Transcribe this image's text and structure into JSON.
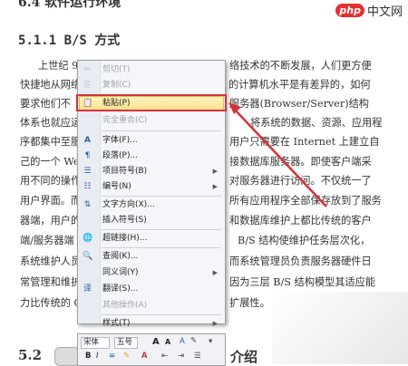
{
  "document": {
    "heading_top": "6.4 软件运行环境",
    "heading_sub": "5.1.1 B/S 方式",
    "left_lines": [
      "上世纪 9",
      "快捷地从网络",
      "要求他们不",
      "体系也就应运",
      "序都集中至服",
      "己的一个 Web",
      "用不同的操作",
      "用户界面。而",
      "器端，用户的",
      "端/服务器端",
      "系统维护人员",
      "常管理和维护",
      "力比传统的 C"
    ],
    "right_lines": [
      "络技术的不断发展，人们更方便",
      "的计算机水平是有差异的，如何",
      "服务器(Browser/Server)结构",
      "将系统的数据、资源、应用程",
      "用户只需要在 Internet 上建立自",
      "接数据库服务器。即使客户端采",
      "对服务器进行访问。不仅统一了",
      "所有应用程序全部保存放到了服务",
      "和数据库维护上都比传统的客户",
      "B/S 结构使维护任务层次化，",
      "而系统管理员负责服务器硬件日",
      "因为三层 B/S 结构模型其适应能",
      "扩展性。"
    ],
    "heading_bottom": "5.2",
    "heading_bottom_right": "介绍"
  },
  "logo": {
    "badge": "php",
    "text": "中文网"
  },
  "context_menu": {
    "items": [
      {
        "label": "剪切(T)",
        "icon": "scissors-icon",
        "glyph": "✂",
        "enabled": false,
        "submenu": false
      },
      {
        "label": "复制(C)",
        "icon": "copy-icon",
        "glyph": "⎘",
        "enabled": false,
        "submenu": false
      },
      {
        "label": "粘贴(P)",
        "icon": "paste-icon",
        "glyph": "📋",
        "enabled": true,
        "submenu": false,
        "highlighted": true
      },
      {
        "label": "完全重合(C)",
        "icon": "",
        "glyph": "",
        "enabled": false,
        "submenu": false
      },
      {
        "label": "字体(F)...",
        "icon": "font-icon",
        "glyph": "A",
        "enabled": true,
        "submenu": false
      },
      {
        "label": "段落(P)...",
        "icon": "paragraph-icon",
        "glyph": "¶",
        "enabled": true,
        "submenu": false
      },
      {
        "label": "项目符号(B)",
        "icon": "bullets-icon",
        "glyph": "☰",
        "enabled": true,
        "submenu": true
      },
      {
        "label": "编号(N)",
        "icon": "numbering-icon",
        "glyph": "☷",
        "enabled": true,
        "submenu": true
      },
      {
        "label": "文字方向(X)...",
        "icon": "text-direction-icon",
        "glyph": "⇅",
        "enabled": true,
        "submenu": false
      },
      {
        "label": "插入符号(S)",
        "icon": "",
        "glyph": "",
        "enabled": true,
        "submenu": false
      },
      {
        "label": "超链接(H)...",
        "icon": "hyperlink-icon",
        "glyph": "🌐",
        "enabled": true,
        "submenu": false
      },
      {
        "label": "查阅(K)...",
        "icon": "lookup-icon",
        "glyph": "🔍",
        "enabled": true,
        "submenu": false
      },
      {
        "label": "同义词(Y)",
        "icon": "",
        "glyph": "",
        "enabled": true,
        "submenu": true
      },
      {
        "label": "翻译(S)...",
        "icon": "translate-icon",
        "glyph": "译",
        "enabled": true,
        "submenu": false
      },
      {
        "label": "其他操作(A)",
        "icon": "",
        "glyph": "",
        "enabled": false,
        "submenu": false
      },
      {
        "label": "样式(T)",
        "icon": "",
        "glyph": "",
        "enabled": true,
        "submenu": true
      }
    ]
  },
  "mini_toolbar": {
    "font": "宋体",
    "size": "五号",
    "grow": "A",
    "shrink": "A",
    "bold": "B",
    "italic": "I"
  },
  "colors": {
    "highlight_border": "#d5323b",
    "arrow": "#d5323b",
    "accent": "#2a5ea8"
  }
}
